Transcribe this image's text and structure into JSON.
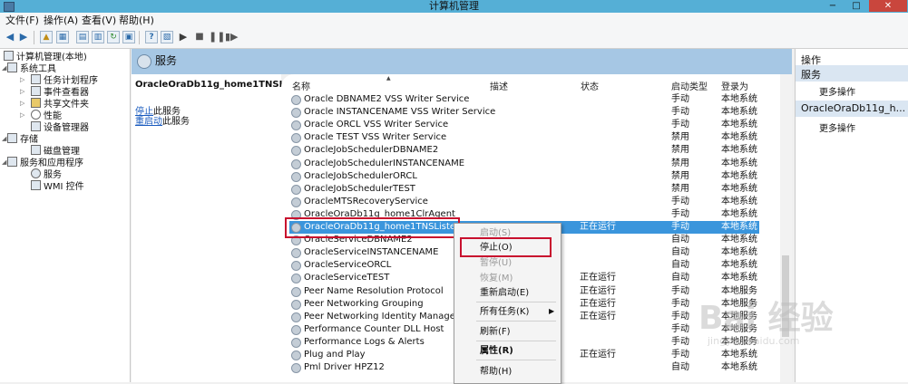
{
  "window": {
    "title": "计算机管理",
    "min": "−",
    "max": "□",
    "close": "✕"
  },
  "menubar": [
    "文件(F)",
    "操作(A)",
    "查看(V)",
    "帮助(H)"
  ],
  "tree": {
    "root": "计算机管理(本地)",
    "items": [
      "系统工具",
      "任务计划程序",
      "事件查看器",
      "共享文件夹",
      "性能",
      "设备管理器",
      "存储",
      "磁盘管理",
      "服务和应用程序",
      "服务",
      "WMI 控件"
    ]
  },
  "services_pane": {
    "header": "服务",
    "selected_name": "OracleOraDb11g_home1TNSListener",
    "stop_link": "停止",
    "stop_text": "此服务",
    "restart_link": "重启动",
    "restart_text": "此服务"
  },
  "columns": [
    "名称",
    "描述",
    "状态",
    "启动类型",
    "登录为"
  ],
  "rows": [
    {
      "name": "Oracle DBNAME2 VSS Writer Service",
      "status": "",
      "startup": "手动",
      "logon": "本地系统"
    },
    {
      "name": "Oracle INSTANCENAME VSS Writer Service",
      "status": "",
      "startup": "手动",
      "logon": "本地系统"
    },
    {
      "name": "Oracle ORCL VSS Writer Service",
      "status": "",
      "startup": "手动",
      "logon": "本地系统"
    },
    {
      "name": "Oracle TEST VSS Writer Service",
      "status": "",
      "startup": "禁用",
      "logon": "本地系统"
    },
    {
      "name": "OracleJobSchedulerDBNAME2",
      "status": "",
      "startup": "禁用",
      "logon": "本地系统"
    },
    {
      "name": "OracleJobSchedulerINSTANCENAME",
      "status": "",
      "startup": "禁用",
      "logon": "本地系统"
    },
    {
      "name": "OracleJobSchedulerORCL",
      "status": "",
      "startup": "禁用",
      "logon": "本地系统"
    },
    {
      "name": "OracleJobSchedulerTEST",
      "status": "",
      "startup": "禁用",
      "logon": "本地系统"
    },
    {
      "name": "OracleMTSRecoveryService",
      "status": "",
      "startup": "手动",
      "logon": "本地系统"
    },
    {
      "name": "OracleOraDb11g_home1ClrAgent",
      "status": "",
      "startup": "手动",
      "logon": "本地系统"
    },
    {
      "name": "OracleOraDb11g_home1TNSListener",
      "status": "正在运行",
      "startup": "手动",
      "logon": "本地系统"
    },
    {
      "name": "OracleServiceDBNAME2",
      "status": "",
      "startup": "自动",
      "logon": "本地系统"
    },
    {
      "name": "OracleServiceINSTANCENAME",
      "status": "",
      "startup": "自动",
      "logon": "本地系统"
    },
    {
      "name": "OracleServiceORCL",
      "status": "",
      "startup": "自动",
      "logon": "本地系统"
    },
    {
      "name": "OracleServiceTEST",
      "status": "正在运行",
      "startup": "自动",
      "logon": "本地系统"
    },
    {
      "name": "Peer Name Resolution Protocol",
      "status": "正在运行",
      "startup": "手动",
      "logon": "本地服务"
    },
    {
      "name": "Peer Networking Grouping",
      "status": "正在运行",
      "startup": "手动",
      "logon": "本地服务"
    },
    {
      "name": "Peer Networking Identity Manager",
      "status": "正在运行",
      "startup": "手动",
      "logon": "本地服务"
    },
    {
      "name": "Performance Counter DLL Host",
      "status": "",
      "startup": "手动",
      "logon": "本地服务"
    },
    {
      "name": "Performance Logs & Alerts",
      "status": "",
      "startup": "手动",
      "logon": "本地服务"
    },
    {
      "name": "Plug and Play",
      "status": "正在运行",
      "startup": "手动",
      "logon": "本地系统"
    },
    {
      "name": "Pml Driver HPZ12",
      "status": "",
      "startup": "自动",
      "logon": "本地系统"
    }
  ],
  "context_menu": {
    "start": "启动(S)",
    "stop": "停止(O)",
    "pause": "暂停(U)",
    "resume": "恢复(M)",
    "restart": "重新启动(E)",
    "all_tasks": "所有任务(K)",
    "refresh": "刷新(F)",
    "properties": "属性(R)",
    "help": "帮助(H)"
  },
  "actions": {
    "title": "操作",
    "section1": "服务",
    "more1": "更多操作",
    "section2": "OracleOraDb11g_h...",
    "more2": "更多操作"
  },
  "watermark": {
    "brand": "Bai 经验",
    "url": "jingyan.baidu.com"
  }
}
